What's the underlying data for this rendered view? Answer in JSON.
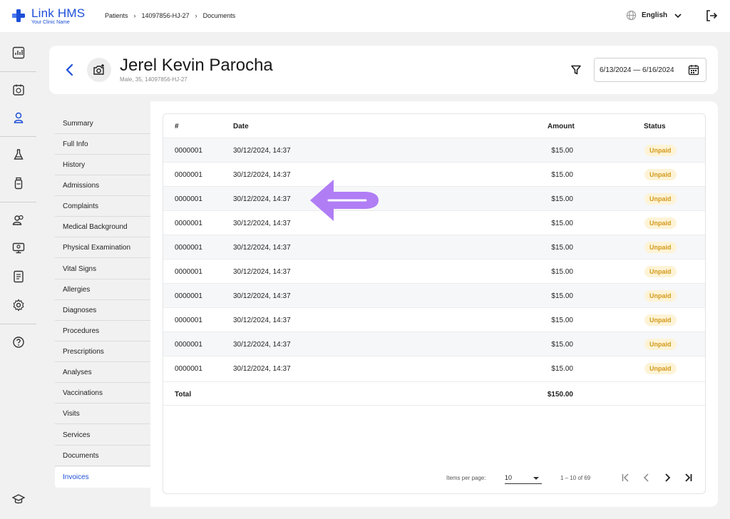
{
  "app": {
    "name": "Link HMS",
    "subtitle": "Your Clinic Name"
  },
  "breadcrumb": [
    "Patients",
    "14097856-HJ-27",
    "Documents"
  ],
  "language": "English",
  "rail_icons": [
    "dashboard-icon",
    "appointments-icon",
    "patients-icon",
    "lab-icon",
    "pharmacy-icon",
    "staff-icon",
    "monitor-icon",
    "reports-icon",
    "settings-icon",
    "help-icon",
    "education-icon"
  ],
  "patient": {
    "name": "Jerel Kevin Parocha",
    "meta": "Male, 35, 14097856-HJ-27"
  },
  "date_range": "6/13/2024 — 6/16/2024",
  "nav": [
    "Summary",
    "Full Info",
    "History",
    "Admissions",
    "Complaints",
    "Medical Background",
    "Physical Examination",
    "Vital Signs",
    "Allergies",
    "Diagnoses",
    "Procedures",
    "Prescriptions",
    "Analyses",
    "Vaccinations",
    "Visits",
    "Services",
    "Documents",
    "Invoices"
  ],
  "nav_active": "Invoices",
  "table": {
    "headers": {
      "num": "#",
      "date": "Date",
      "amount": "Amount",
      "status": "Status"
    },
    "rows": [
      {
        "num": "0000001",
        "date": "30/12/2024, 14:37",
        "amount": "$15.00",
        "status": "Unpaid"
      },
      {
        "num": "0000001",
        "date": "30/12/2024, 14:37",
        "amount": "$15.00",
        "status": "Unpaid"
      },
      {
        "num": "0000001",
        "date": "30/12/2024, 14:37",
        "amount": "$15.00",
        "status": "Unpaid"
      },
      {
        "num": "0000001",
        "date": "30/12/2024, 14:37",
        "amount": "$15.00",
        "status": "Unpaid"
      },
      {
        "num": "0000001",
        "date": "30/12/2024, 14:37",
        "amount": "$15.00",
        "status": "Unpaid"
      },
      {
        "num": "0000001",
        "date": "30/12/2024, 14:37",
        "amount": "$15.00",
        "status": "Unpaid"
      },
      {
        "num": "0000001",
        "date": "30/12/2024, 14:37",
        "amount": "$15.00",
        "status": "Unpaid"
      },
      {
        "num": "0000001",
        "date": "30/12/2024, 14:37",
        "amount": "$15.00",
        "status": "Unpaid"
      },
      {
        "num": "0000001",
        "date": "30/12/2024, 14:37",
        "amount": "$15.00",
        "status": "Unpaid"
      },
      {
        "num": "0000001",
        "date": "30/12/2024, 14:37",
        "amount": "$15.00",
        "status": "Unpaid"
      }
    ],
    "total_label": "Total",
    "total_amount": "$150.00"
  },
  "pagination": {
    "items_label": "Items per page:",
    "per_page": "10",
    "range": "1 – 10 of 69"
  },
  "colors": {
    "brand": "#1d4fd8",
    "status_unpaid_bg": "#fdf3d6",
    "status_unpaid_text": "#d39a1b",
    "overlay_arrow": "#b07df5"
  }
}
